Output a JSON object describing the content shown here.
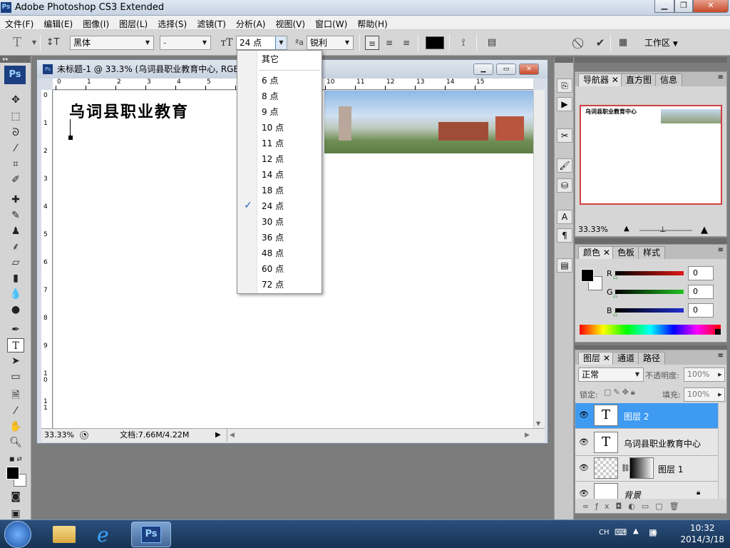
{
  "app": {
    "title": "Adobe Photoshop CS3 Extended",
    "logo": "Ps"
  },
  "menu": [
    "文件(F)",
    "编辑(E)",
    "图像(I)",
    "图层(L)",
    "选择(S)",
    "滤镜(T)",
    "分析(A)",
    "视图(V)",
    "窗口(W)",
    "帮助(H)"
  ],
  "options": {
    "font_family": "黑体",
    "font_style": "-",
    "font_size": "24 点",
    "antialias_label": "a",
    "antialias_value": "锐利",
    "workspace": "工作区",
    "text_color": "#000000"
  },
  "document": {
    "title": "未标题-1 @ 33.3% (乌词县职业教育中心, RGB/",
    "canvas_text": "乌词县职业教育",
    "zoom": "33.33%",
    "doc_info": "文档:7.66M/4.22M",
    "hruler_labels": [
      "0",
      "1",
      "2",
      "3",
      "4",
      "5",
      "6",
      "10",
      "11",
      "12",
      "13",
      "14",
      "15"
    ],
    "vruler_labels": [
      "0",
      "1",
      "2",
      "3",
      "4",
      "5",
      "6",
      "7",
      "8",
      "9",
      "1\n0",
      "1\n1"
    ]
  },
  "size_menu": {
    "other": "其它",
    "items": [
      "6 点",
      "8 点",
      "9 点",
      "10 点",
      "11 点",
      "12 点",
      "14 点",
      "18 点",
      "24 点",
      "30 点",
      "36 点",
      "48 点",
      "60 点",
      "72 点"
    ],
    "checked": "24 点"
  },
  "navigator": {
    "tabs": [
      "导航器",
      "直方图",
      "信息"
    ],
    "zoom": "33.33%",
    "thumb_text": "乌词县职业教育中心"
  },
  "color": {
    "tabs": [
      "颜色",
      "色板",
      "样式"
    ],
    "channels": [
      {
        "label": "R",
        "value": "0",
        "color": "#d02020"
      },
      {
        "label": "G",
        "value": "0",
        "color": "#20b020"
      },
      {
        "label": "B",
        "value": "0",
        "color": "#2030c8"
      }
    ]
  },
  "layers": {
    "tabs": [
      "图层",
      "通道",
      "路径"
    ],
    "blend_mode": "正常",
    "opacity_label": "不透明度:",
    "opacity_value": "100%",
    "lock_label": "锁定:",
    "fill_label": "填充:",
    "fill_value": "100%",
    "rows": [
      {
        "name": "图层 2",
        "type": "text",
        "selected": true
      },
      {
        "name": "乌词县职业教育中心",
        "type": "text",
        "selected": false
      },
      {
        "name": "图层 1",
        "type": "masked",
        "selected": false
      },
      {
        "name": "背景",
        "type": "background",
        "selected": false
      }
    ]
  },
  "taskbar": {
    "ime": "CH",
    "time": "10:32",
    "date": "2014/3/18",
    "ps_label": "Ps"
  }
}
